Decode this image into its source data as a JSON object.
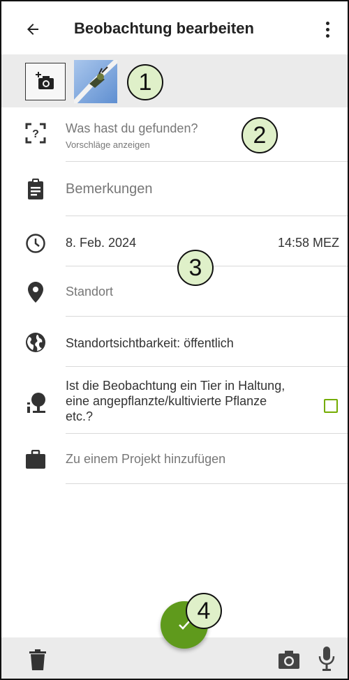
{
  "header": {
    "title": "Beobachtung bearbeiten",
    "back_icon": "arrow-left-icon",
    "more_icon": "more-vertical-icon"
  },
  "photos": {
    "add_icon": "add-photo-icon",
    "thumbnail_alt": "Beobachtungsfoto"
  },
  "callouts": [
    "1",
    "2",
    "3",
    "4"
  ],
  "identification": {
    "title": "Was hast du gefunden?",
    "subtitle": "Vorschläge anzeigen",
    "icon": "unknown-taxon-icon"
  },
  "notes": {
    "placeholder": "Bemerkungen",
    "icon": "clipboard-icon"
  },
  "datetime": {
    "date": "8. Feb. 2024",
    "time": "14:58 MEZ",
    "icon": "clock-icon"
  },
  "location": {
    "placeholder": "Standort",
    "icon": "location-pin-icon"
  },
  "geoprivacy": {
    "label": "Standortsichtbarkeit: öffentlich",
    "icon": "globe-icon"
  },
  "captive": {
    "label": "Ist die Beobachtung ein Tier in Haltung, eine angepflanzte/kultivierte Pflanze etc.?",
    "line1": "Ist die Beobachtung ein Tier in Haltung,",
    "line2": "eine angepflanzte/kultivierte Pflanze",
    "line3": "etc.?",
    "checked": false,
    "icon": "captive-tree-icon"
  },
  "project": {
    "label": "Zu einem Projekt hinzufügen",
    "icon": "briefcase-icon"
  },
  "fab": {
    "icon": "checkmark-icon"
  },
  "bottom_bar": {
    "delete_icon": "trash-icon",
    "camera_icon": "camera-icon",
    "mic_icon": "microphone-icon"
  },
  "colors": {
    "accent": "#74ac00",
    "fab": "#5f9a1c",
    "callout_fill": "#dff0c9",
    "bar_background": "#ebebeb"
  }
}
